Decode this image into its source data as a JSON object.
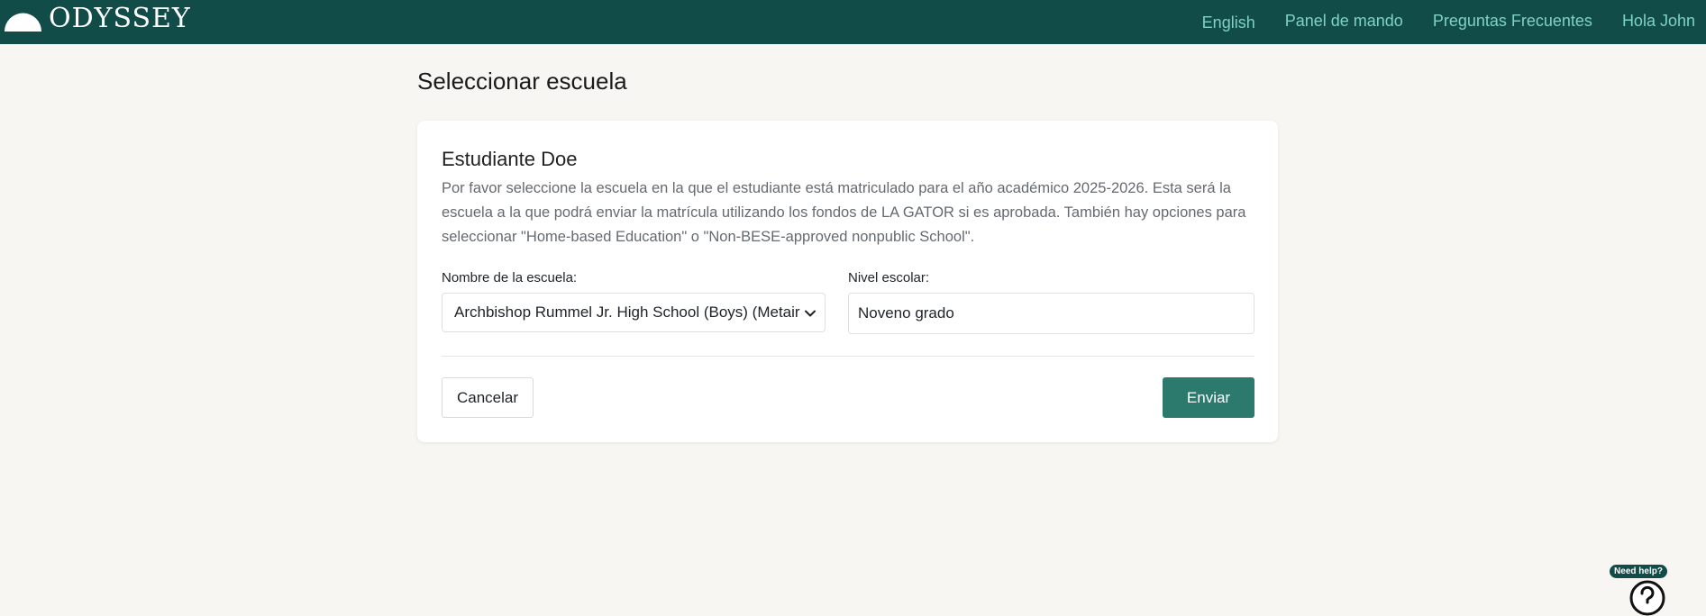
{
  "brand": {
    "name": "ODYSSEY"
  },
  "nav": {
    "items": [
      {
        "label": "English"
      },
      {
        "label": "Panel de mando"
      },
      {
        "label": "Preguntas Frecuentes"
      },
      {
        "label": "Hola John"
      }
    ]
  },
  "page": {
    "title": "Seleccionar escuela"
  },
  "card": {
    "student_name": "Estudiante Doe",
    "description": "Por favor seleccione la escuela en la que el estudiante está matriculado para el año académico 2025-2026. Esta será la escuela a la que podrá enviar la matrícula utilizando los fondos de LA GATOR si es aprobada. También hay opciones para seleccionar \"Home-based Education\" o \"Non-BESE-approved nonpublic School\".",
    "school_label": "Nombre de la escuela:",
    "school_value": "Archbishop Rummel Jr. High School (Boys) (Metairie)",
    "grade_label": "Nivel escolar:",
    "grade_value": "Noveno grado",
    "cancel_label": "Cancelar",
    "submit_label": "Enviar"
  },
  "help": {
    "badge": "Need help?",
    "icon": "question-circle-icon"
  },
  "colors": {
    "header_bg": "#114c48",
    "nav_link": "#7fd1c5",
    "primary_button": "#2c7a6e",
    "page_bg": "#f8f6f2"
  }
}
